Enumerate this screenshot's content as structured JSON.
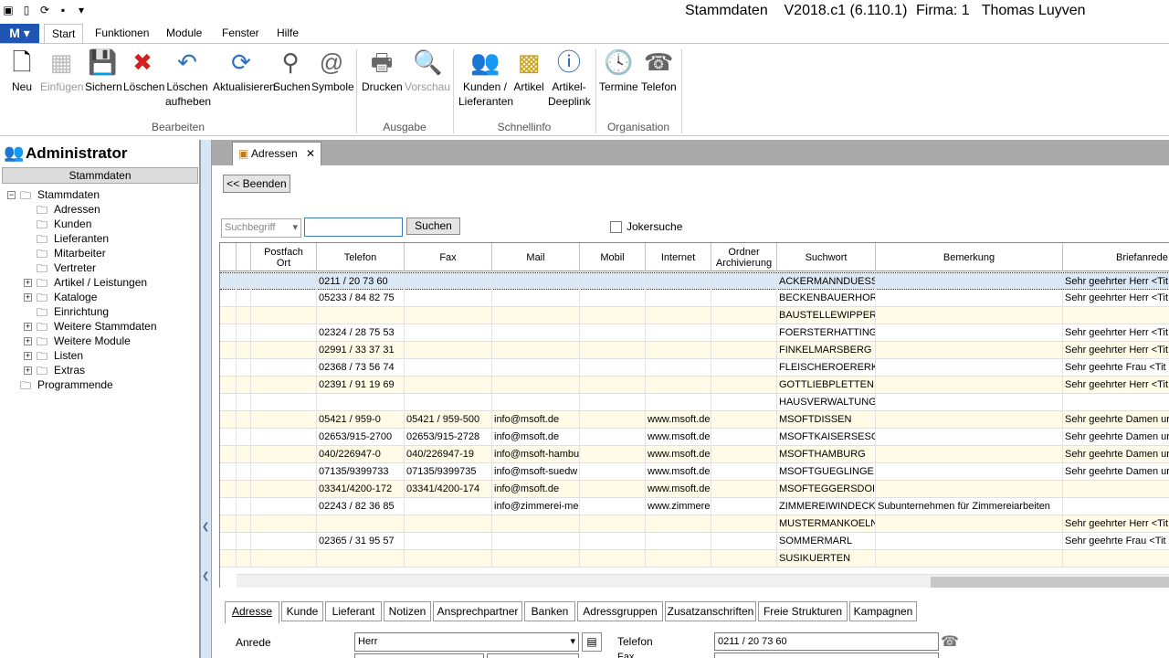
{
  "window": {
    "title": "Stammdaten    V2018.c1 (6.110.1)",
    "firma": "Firma: 1   Thomas Luyven"
  },
  "ribbon": {
    "tabs": [
      "Start",
      "Funktionen",
      "Module",
      "Fenster",
      "Hilfe"
    ],
    "buttons": {
      "neu": "Neu",
      "einfuegen": "Einfügen",
      "sichern": "Sichern",
      "loeschen": "Löschen",
      "loeschen_aufheben_1": "Löschen",
      "loeschen_aufheben_2": "aufheben",
      "aktualisieren": "Aktualisieren",
      "suchen": "Suchen",
      "symbole": "Symbole",
      "drucken": "Drucken",
      "vorschau": "Vorschau",
      "kunden_1": "Kunden /",
      "kunden_2": "Lieferanten",
      "artikel": "Artikel",
      "deeplink_1": "Artikel-",
      "deeplink_2": "Deeplink",
      "termine": "Termine",
      "telefon": "Telefon"
    },
    "groups": {
      "bearbeiten": "Bearbeiten",
      "ausgabe": "Ausgabe",
      "schnellinfo": "Schnellinfo",
      "organisation": "Organisation"
    }
  },
  "sidebar": {
    "user": "Administrator",
    "section": "Stammdaten",
    "tree": [
      "Stammdaten",
      "Adressen",
      "Kunden",
      "Lieferanten",
      "Mitarbeiter",
      "Vertreter",
      "Artikel / Leistungen",
      "Kataloge",
      "Einrichtung",
      "Weitere Stammdaten",
      "Weitere Module",
      "Listen",
      "Extras",
      "Programmende"
    ]
  },
  "doc": {
    "tab_label": "Adressen",
    "beenden": "<< Beenden",
    "suchbegriff": "Suchbegriff",
    "search_value": "",
    "suchen": "Suchen",
    "jokersuche": "Jokersuche"
  },
  "grid": {
    "headers": {
      "postfach_1": "Postfach",
      "postfach_2": "Ort",
      "telefon": "Telefon",
      "fax": "Fax",
      "mail": "Mail",
      "mobil": "Mobil",
      "internet": "Internet",
      "ordner_1": "Ordner",
      "ordner_2": "Archivierung",
      "suchwort": "Suchwort",
      "bemerkung": "Bemerkung",
      "briefanrede": "Briefanrede"
    },
    "rows": [
      {
        "telefon": "0211 / 20 73 60",
        "fax": "",
        "mail": "",
        "internet": "",
        "suchwort": "ACKERMANNDUESS",
        "bemerkung": "",
        "anrede": "Sehr geehrter Herr <Tit"
      },
      {
        "telefon": "05233 / 84 82 75",
        "fax": "",
        "mail": "",
        "internet": "",
        "suchwort": "BECKENBAUERHOR",
        "bemerkung": "",
        "anrede": "Sehr geehrter Herr <Tit"
      },
      {
        "telefon": "",
        "fax": "",
        "mail": "",
        "internet": "",
        "suchwort": "BAUSTELLEWIPPER",
        "bemerkung": "",
        "anrede": ""
      },
      {
        "telefon": "02324 / 28 75 53",
        "fax": "",
        "mail": "",
        "internet": "",
        "suchwort": "FOERSTERHATTING",
        "bemerkung": "",
        "anrede": "Sehr geehrter Herr <Tit"
      },
      {
        "telefon": "02991 / 33 37 31",
        "fax": "",
        "mail": "",
        "internet": "",
        "suchwort": "FINKELMARSBERG",
        "bemerkung": "",
        "anrede": "Sehr geehrter Herr <Tit"
      },
      {
        "telefon": "02368 / 73 56 74",
        "fax": "",
        "mail": "",
        "internet": "",
        "suchwort": "FLEISCHEROERERK",
        "bemerkung": "",
        "anrede": "Sehr geehrte Frau <Tit"
      },
      {
        "telefon": "02391 / 91 19 69",
        "fax": "",
        "mail": "",
        "internet": "",
        "suchwort": "GOTTLIEBPLETTEN",
        "bemerkung": "",
        "anrede": "Sehr geehrter Herr <Tit"
      },
      {
        "telefon": "",
        "fax": "",
        "mail": "",
        "internet": "",
        "suchwort": "HAUSVERWALTUNG",
        "bemerkung": "",
        "anrede": ""
      },
      {
        "telefon": "05421 / 959-0",
        "fax": "05421 / 959-500",
        "mail": "info@msoft.de",
        "internet": "www.msoft.de",
        "suchwort": "MSOFTDISSEN",
        "bemerkung": "",
        "anrede": "Sehr geehrte Damen ur"
      },
      {
        "telefon": "02653/915-2700",
        "fax": "02653/915-2728",
        "mail": "info@msoft.de",
        "internet": "www.msoft.de",
        "suchwort": "MSOFTKAISERSESC",
        "bemerkung": "",
        "anrede": "Sehr geehrte Damen ur"
      },
      {
        "telefon": "040/226947-0",
        "fax": "040/226947-19",
        "mail": "info@msoft-hambu",
        "internet": "www.msoft.de",
        "suchwort": "MSOFTHAMBURG",
        "bemerkung": "",
        "anrede": "Sehr geehrte Damen ur"
      },
      {
        "telefon": "07135/9399733",
        "fax": "07135/9399735",
        "mail": "info@msoft-suedw",
        "internet": "www.msoft.de",
        "suchwort": "MSOFTGUEGLINGE",
        "bemerkung": "",
        "anrede": "Sehr geehrte Damen ur"
      },
      {
        "telefon": "03341/4200-172",
        "fax": "03341/4200-174",
        "mail": "info@msoft.de",
        "internet": "www.msoft.de",
        "suchwort": "MSOFTEGGERSDOI",
        "bemerkung": "",
        "anrede": ""
      },
      {
        "telefon": "02243 / 82 36 85",
        "fax": "",
        "mail": "info@zimmerei-me",
        "internet": "www.zimmere",
        "suchwort": "ZIMMEREIWINDECK",
        "bemerkung": "Subunternehmen für Zimmereiarbeiten",
        "anrede": ""
      },
      {
        "telefon": "",
        "fax": "",
        "mail": "",
        "internet": "",
        "suchwort": "MUSTERMANKOELN",
        "bemerkung": "",
        "anrede": "Sehr geehrter Herr <Tit"
      },
      {
        "telefon": "02365 / 31 95 57",
        "fax": "",
        "mail": "",
        "internet": "",
        "suchwort": "SOMMERMARL",
        "bemerkung": "",
        "anrede": "Sehr geehrte Frau <Tit"
      },
      {
        "telefon": "",
        "fax": "",
        "mail": "",
        "internet": "",
        "suchwort": "SUSIKUERTEN",
        "bemerkung": "",
        "anrede": ""
      }
    ]
  },
  "detail_tabs": [
    "Adresse",
    "Kunde",
    "Lieferant",
    "Notizen",
    "Ansprechpartner",
    "Banken",
    "Adressgruppen",
    "Zusatzanschriften",
    "Freie Strukturen",
    "Kampagnen"
  ],
  "form": {
    "anrede_label": "Anrede",
    "anrede_value": "Herr",
    "telefon_label": "Telefon",
    "telefon_value": "0211 / 20 73 60",
    "fax_label": "Fax"
  }
}
